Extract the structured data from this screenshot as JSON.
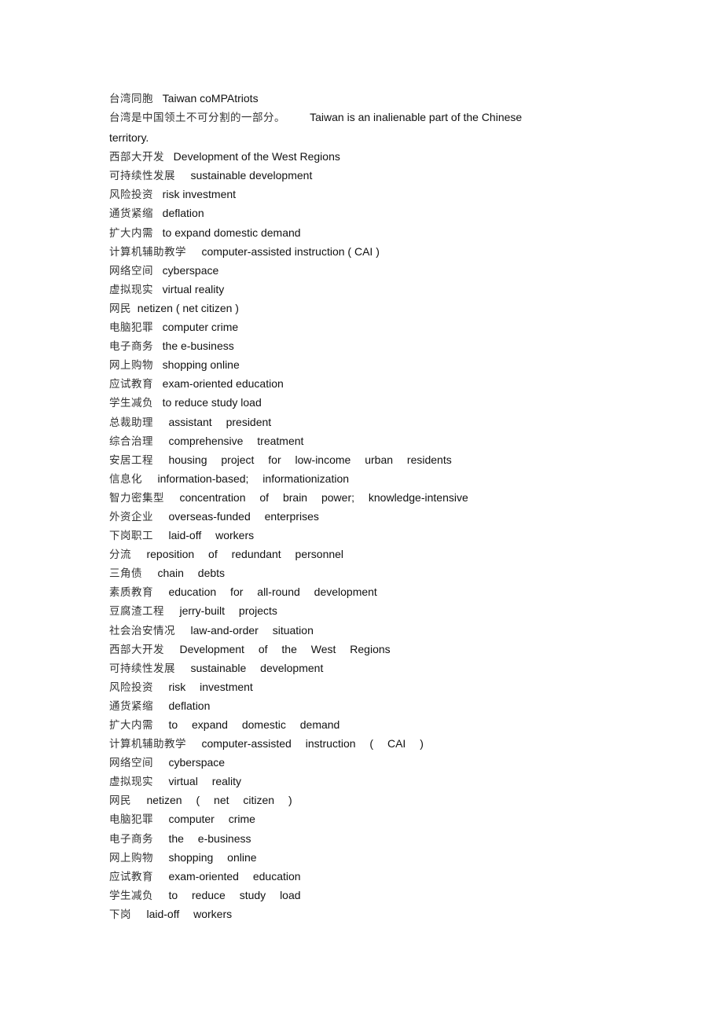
{
  "entries": [
    {
      "zh": "台湾同胞",
      "gap": "   ",
      "en": "Taiwan coMPAtriots"
    },
    {
      "zh": "台湾是中国领土不可分割的一部分。",
      "gap": "        ",
      "en": "Taiwan is an inalienable part of the Chinese"
    },
    {
      "zh": "",
      "gap": "",
      "en": "territory."
    },
    {
      "zh": "西部大开发",
      "gap": "   ",
      "en": "Development of the West Regions"
    },
    {
      "zh": "可持续性发展",
      "gap": "     ",
      "en": "sustainable development"
    },
    {
      "zh": "风险投资",
      "gap": "   ",
      "en": "risk investment"
    },
    {
      "zh": "通货紧缩",
      "gap": "   ",
      "en": "deflation"
    },
    {
      "zh": "扩大内需",
      "gap": "   ",
      "en": "to expand domestic demand"
    },
    {
      "zh": "计算机辅助教学",
      "gap": "     ",
      "en": "computer-assisted instruction ( CAI )"
    },
    {
      "zh": "网络空间",
      "gap": "   ",
      "en": "cyberspace"
    },
    {
      "zh": "虚拟现实",
      "gap": "   ",
      "en": "virtual reality"
    },
    {
      "zh": "网民",
      "gap": "  ",
      "en": "netizen ( net citizen )"
    },
    {
      "zh": "电脑犯罪",
      "gap": "   ",
      "en": "computer crime"
    },
    {
      "zh": "电子商务",
      "gap": "   ",
      "en": "the e-business"
    },
    {
      "zh": "网上购物",
      "gap": "   ",
      "en": "shopping online"
    },
    {
      "zh": "应试教育",
      "gap": "   ",
      "en": "exam-oriented education"
    },
    {
      "zh": "学生减负",
      "gap": "   ",
      "en": "to reduce study load"
    },
    {
      "zh": "总裁助理",
      "gap": "     ",
      "en": "assistant president"
    },
    {
      "zh": "综合治理",
      "gap": "     ",
      "en": "comprehensive treatment"
    },
    {
      "zh": "安居工程",
      "gap": "     ",
      "en": "housing project for low-income urban residents"
    },
    {
      "zh": "信息化",
      "gap": "     ",
      "en": "information-based; informationization"
    },
    {
      "zh": "智力密集型",
      "gap": "     ",
      "en": "concentration of brain power; knowledge-intensive"
    },
    {
      "zh": "外资企业",
      "gap": "     ",
      "en": "overseas-funded enterprises"
    },
    {
      "zh": "下岗职工",
      "gap": "     ",
      "en": "laid-off workers"
    },
    {
      "zh": "分流",
      "gap": "     ",
      "en": "reposition of redundant personnel"
    },
    {
      "zh": "三角债",
      "gap": "     ",
      "en": "chain debts"
    },
    {
      "zh": "素质教育",
      "gap": "     ",
      "en": "education for all-round development"
    },
    {
      "zh": "豆腐渣工程",
      "gap": "     ",
      "en": "jerry-built projects"
    },
    {
      "zh": "社会治安情况",
      "gap": "     ",
      "en": "law-and-order situation"
    },
    {
      "zh": "西部大开发",
      "gap": "     ",
      "en": "Development of the West Regions"
    },
    {
      "zh": "可持续性发展",
      "gap": "     ",
      "en": "sustainable development"
    },
    {
      "zh": "风险投资",
      "gap": "     ",
      "en": "risk investment"
    },
    {
      "zh": "通货紧缩",
      "gap": "     ",
      "en": "deflation"
    },
    {
      "zh": "扩大内需",
      "gap": "     ",
      "en": "to expand domestic demand"
    },
    {
      "zh": "计算机辅助教学",
      "gap": "     ",
      "en": "computer-assisted instruction ( CAI )"
    },
    {
      "zh": "网络空间",
      "gap": "     ",
      "en": "cyberspace"
    },
    {
      "zh": "虚拟现实",
      "gap": "     ",
      "en": "virtual reality"
    },
    {
      "zh": "网民",
      "gap": "     ",
      "en": "netizen ( net citizen )"
    },
    {
      "zh": "电脑犯罪",
      "gap": "     ",
      "en": "computer crime"
    },
    {
      "zh": "电子商务",
      "gap": "     ",
      "en": "the e-business"
    },
    {
      "zh": "网上购物",
      "gap": "     ",
      "en": "shopping online"
    },
    {
      "zh": "应试教育",
      "gap": "     ",
      "en": "exam-oriented education"
    },
    {
      "zh": "学生减负",
      "gap": "     ",
      "en": "to reduce study load"
    },
    {
      "zh": "下岗",
      "gap": "     ",
      "en": "laid-off workers"
    }
  ],
  "wide_from_index": 17
}
